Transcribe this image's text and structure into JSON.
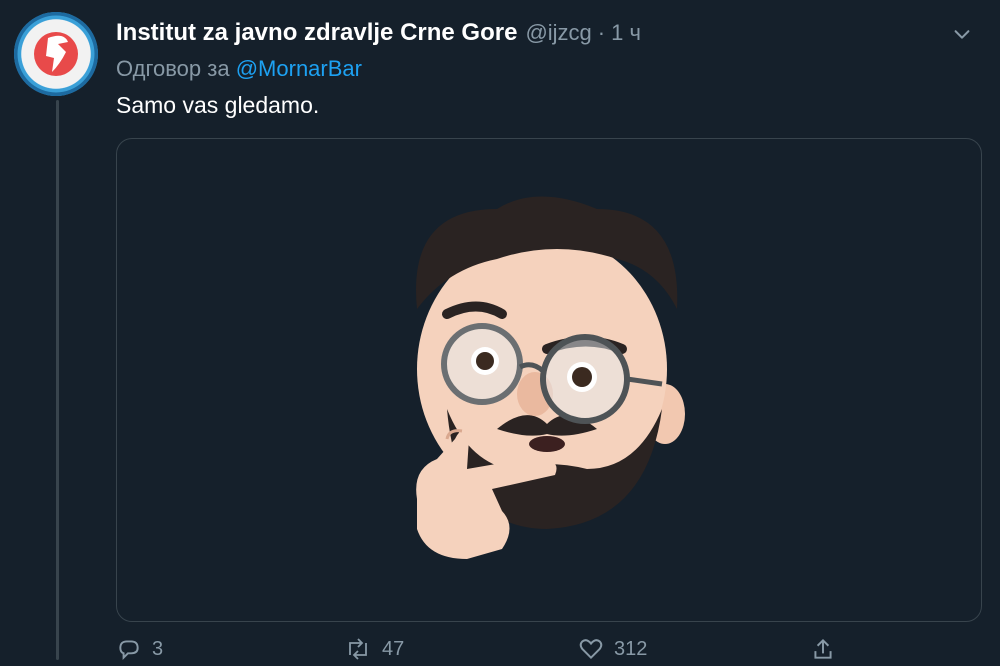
{
  "tweet": {
    "display_name": "Institut za javno zdravlje Crne Gore",
    "handle": "@ijzcg",
    "separator": "·",
    "time": "1 ч",
    "replying_to_prefix": "Одговор за",
    "replying_to_mention": "@MornarBar",
    "text": "Samo vas gledamo.",
    "media": {
      "description_icon": "thinking-memoji-image"
    }
  },
  "actions": {
    "reply_count": "3",
    "retweet_count": "47",
    "like_count": "312"
  },
  "icons": {
    "menu": "chevron-down-icon",
    "reply": "reply-icon",
    "retweet": "retweet-icon",
    "like": "heart-icon",
    "share": "share-icon"
  },
  "colors": {
    "background": "#15202b",
    "secondary_text": "#8899a6",
    "link": "#1da1f2",
    "border": "#38444d"
  }
}
